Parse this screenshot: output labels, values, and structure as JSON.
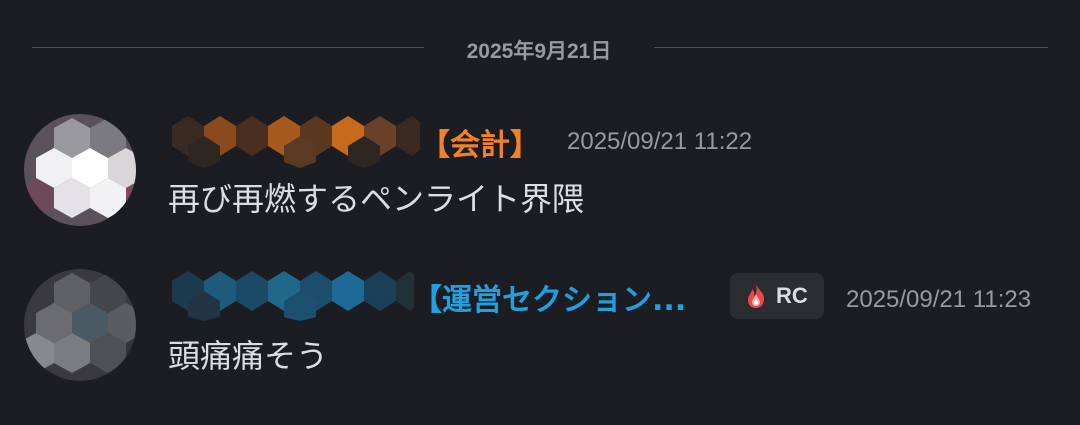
{
  "date_divider": "2025年9月21日",
  "messages": [
    {
      "role_tag": "【会計】",
      "timestamp": "2025/09/21 11:22",
      "text": "再び再燃するペンライト界隈",
      "name_color": "#c86a1e"
    },
    {
      "role_tag": "【運営セクション...",
      "badge": {
        "icon": "flame-icon",
        "label": "RC"
      },
      "timestamp": "2025/09/21 11:23",
      "text": "頭痛痛そう",
      "name_color": "#1e6a96"
    }
  ]
}
